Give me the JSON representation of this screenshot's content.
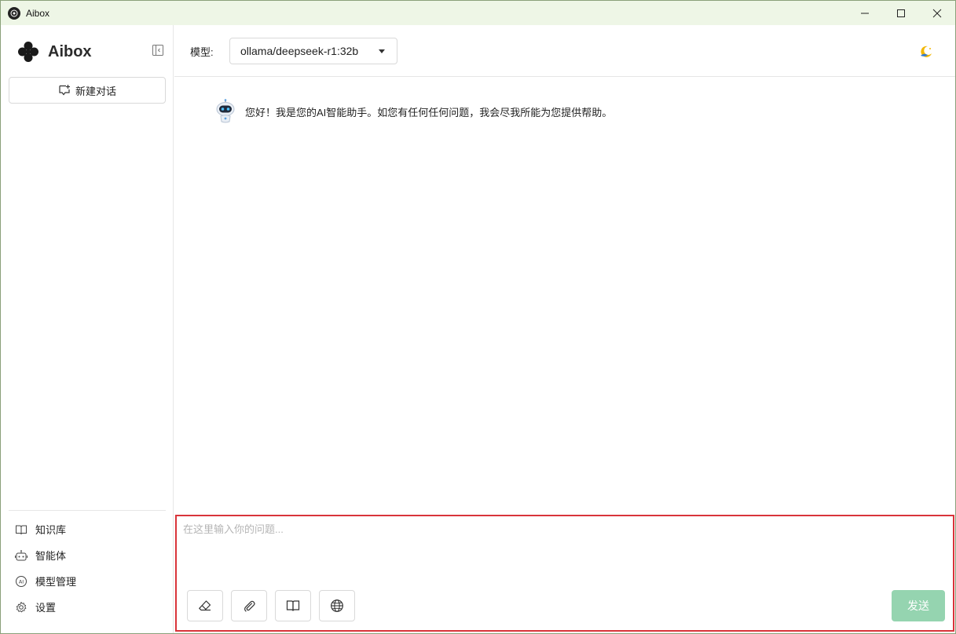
{
  "window": {
    "title": "Aibox"
  },
  "sidebar": {
    "brand": "Aibox",
    "new_chat_label": "新建对话",
    "menu": [
      {
        "label": "知识库",
        "icon": "book-icon"
      },
      {
        "label": "智能体",
        "icon": "robot-icon"
      },
      {
        "label": "模型管理",
        "icon": "ai-circle-icon"
      },
      {
        "label": "设置",
        "icon": "gear-icon"
      }
    ]
  },
  "header": {
    "model_label": "模型:",
    "model_value": "ollama/deepseek-r1:32b"
  },
  "messages": [
    {
      "role": "assistant",
      "text": "您好！我是您的AI智能助手。如您有任何任何问题，我会尽我所能为您提供帮助。"
    }
  ],
  "composer": {
    "placeholder": "在这里输入你的问题...",
    "value": "",
    "send_label": "发送",
    "tools": [
      "eraser-icon",
      "paperclip-icon",
      "book-icon",
      "globe-icon"
    ]
  },
  "colors": {
    "titlebar_bg": "#eef6e6",
    "send_button": "#95d4b0",
    "composer_border": "#d9343a"
  }
}
